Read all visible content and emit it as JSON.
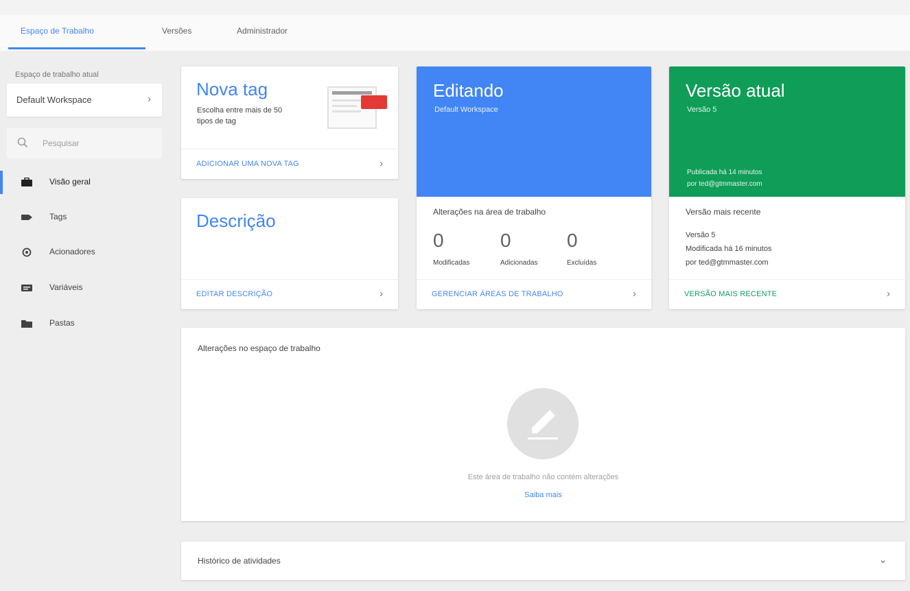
{
  "tabs": [
    {
      "label": "Espaço de Trabalho",
      "active": true
    },
    {
      "label": "Versões",
      "active": false
    },
    {
      "label": "Administrador",
      "active": false
    }
  ],
  "sidebar": {
    "workspace_caption": "Espaço de trabalho atual",
    "workspace_name": "Default Workspace",
    "search_placeholder": "Pesquisar",
    "items": [
      {
        "label": "Visão geral",
        "icon": "briefcase-icon",
        "active": true
      },
      {
        "label": "Tags",
        "icon": "tag-icon",
        "active": false
      },
      {
        "label": "Acionadores",
        "icon": "trigger-icon",
        "active": false
      },
      {
        "label": "Variáveis",
        "icon": "variables-icon",
        "active": false
      },
      {
        "label": "Pastas",
        "icon": "folder-icon",
        "active": false
      }
    ]
  },
  "new_tag_card": {
    "title": "Nova tag",
    "description": "Escolha entre mais de 50 tipos de tag",
    "footer": "ADICIONAR UMA NOVA TAG"
  },
  "description_card": {
    "title": "Descrição",
    "footer": "EDITAR DESCRIÇÃO"
  },
  "editing_card": {
    "title": "Editando",
    "subtitle": "Default Workspace",
    "heading": "Alterações na área de trabalho",
    "counters": [
      {
        "value": "0",
        "label": "Modificadas"
      },
      {
        "value": "0",
        "label": "Adicionadas"
      },
      {
        "value": "0",
        "label": "Excluídas"
      }
    ],
    "footer": "GERENCIAR ÁREAS DE TRABALHO"
  },
  "version_card": {
    "title": "Versão atual",
    "subtitle": "Versão 5",
    "note_line1": "Publicada há 14 minutos",
    "note_line2": "por ted@gtmmaster.com",
    "heading": "Versão mais recente",
    "version_line": "Versão 5",
    "modified_line1": "Modificada há 16 minutos",
    "modified_line2": "por ted@gtmmaster.com",
    "footer": "VERSÃO MAIS RECENTE"
  },
  "changes_card": {
    "title": "Alterações no espaço de trabalho",
    "empty_text": "Este área de trabalho não contém alterações",
    "learn_more": "Saiba mais"
  },
  "activity_card": {
    "title": "Histórico de atividades"
  },
  "colors": {
    "accent": "#4285f4",
    "editing_blue": "#4285f4",
    "version_green": "#0f9d58",
    "badge_red": "#e53935"
  }
}
